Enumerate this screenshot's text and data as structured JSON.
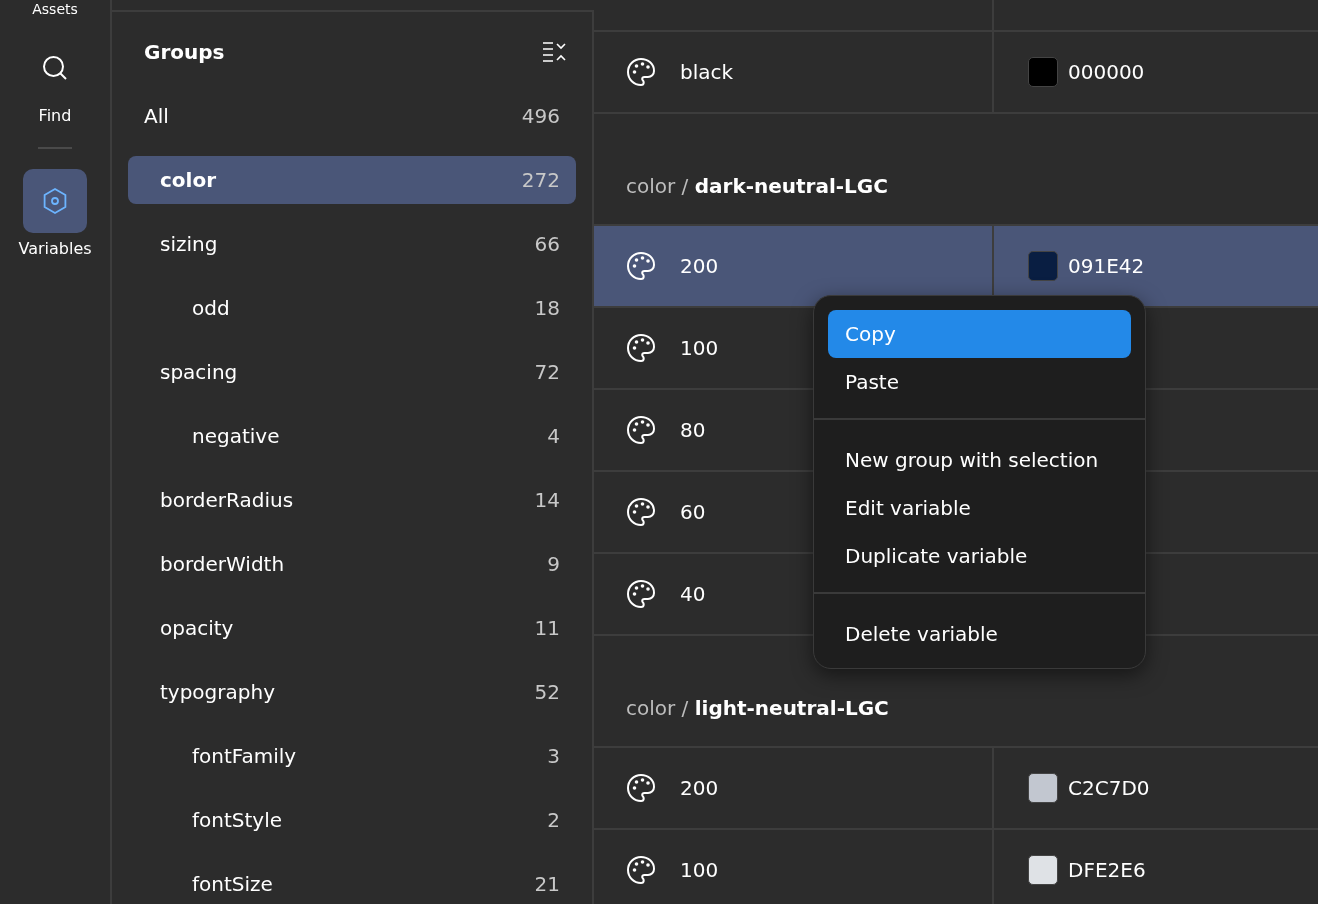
{
  "rail": {
    "top_label": "Assets",
    "items": [
      {
        "label": "Find",
        "selected": false
      },
      {
        "label": "Variables",
        "selected": true
      }
    ]
  },
  "groups": {
    "title": "Groups",
    "items": [
      {
        "label": "All",
        "count": "496",
        "selected": false
      },
      {
        "label": "color",
        "count": "272",
        "selected": true
      },
      {
        "label": "sizing",
        "count": "66",
        "selected": false,
        "children": [
          {
            "label": "odd",
            "count": "18",
            "selected": false
          }
        ]
      },
      {
        "label": "spacing",
        "count": "72",
        "selected": false,
        "children": [
          {
            "label": "negative",
            "count": "4",
            "selected": false
          }
        ]
      },
      {
        "label": "borderRadius",
        "count": "14",
        "selected": false
      },
      {
        "label": "borderWidth",
        "count": "9",
        "selected": false
      },
      {
        "label": "opacity",
        "count": "11",
        "selected": false
      },
      {
        "label": "typography",
        "count": "52",
        "selected": false,
        "children": [
          {
            "label": "fontFamily",
            "count": "3",
            "selected": false
          },
          {
            "label": "fontStyle",
            "count": "2",
            "selected": false
          },
          {
            "label": "fontSize",
            "count": "21",
            "selected": false
          }
        ]
      }
    ]
  },
  "table": {
    "sections": [
      {
        "rows": [
          {
            "name": "black",
            "value": "000000",
            "color": "#000000",
            "selected": false
          }
        ]
      },
      {
        "path": "color / ",
        "group": "dark-neutral-LGC",
        "rows": [
          {
            "name": "200",
            "value": "091E42",
            "color": "#091e42",
            "selected": true
          },
          {
            "name": "100",
            "selected": false
          },
          {
            "name": "80",
            "selected": false
          },
          {
            "name": "60",
            "selected": false
          },
          {
            "name": "40",
            "selected": false
          }
        ]
      },
      {
        "path": "color / ",
        "group": "light-neutral-LGC",
        "rows": [
          {
            "name": "200",
            "value": "C2C7D0",
            "color": "#c2c7d0",
            "selected": false
          },
          {
            "name": "100",
            "value": "DFE2E6",
            "color": "#dfe2e6",
            "selected": false
          }
        ]
      }
    ]
  },
  "context_menu": {
    "sections": [
      [
        {
          "label": "Copy",
          "selected": true
        },
        {
          "label": "Paste",
          "selected": false
        }
      ],
      [
        {
          "label": "New group with selection",
          "selected": false
        },
        {
          "label": "Edit variable",
          "selected": false
        },
        {
          "label": "Duplicate variable",
          "selected": false
        }
      ],
      [
        {
          "label": "Delete variable",
          "selected": false
        }
      ]
    ]
  }
}
